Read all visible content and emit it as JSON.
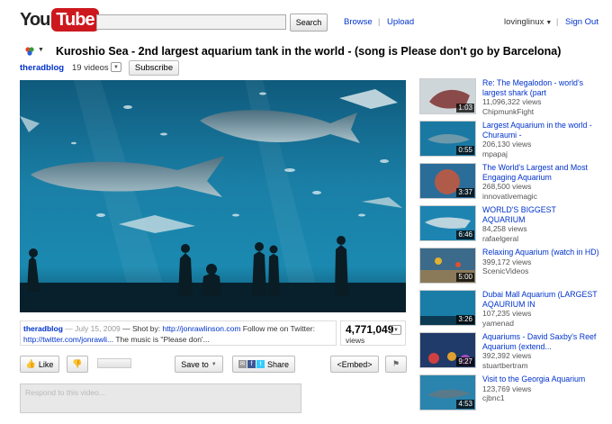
{
  "header": {
    "logo_you": "You",
    "logo_tube": "Tube",
    "search_button": "Search",
    "search_placeholder": "",
    "nav_browse": "Browse",
    "nav_upload": "Upload",
    "separator": "|",
    "username": "lovinglinux",
    "sign_out": "Sign Out"
  },
  "video": {
    "title": "Kuroshio Sea - 2nd largest aquarium tank in the world - (song is Please don't go by Barcelona)",
    "channel": "theradblog",
    "video_count": "19 videos",
    "subscribe": "Subscribe",
    "desc_channel": "theradblog",
    "desc_date": " — July 15, 2009",
    "desc_text_1": " — Shot by: ",
    "desc_link_1": "http://jonrawlinson.com",
    "desc_text_2": " Follow me on Twitter: ",
    "desc_link_2": "http://twitter.com/jonrawli...",
    "desc_text_3": " The music is \"Please don'...",
    "views_count": "4,771,049",
    "views_label": "views"
  },
  "actions": {
    "like": "Like",
    "save_to": "Save to",
    "share": "Share",
    "embed": "<Embed>",
    "respond_placeholder": "Respond to this video..."
  },
  "related": [
    {
      "title": "Re: The Megalodon - world's largest shark (part",
      "views": "11,096,322 views",
      "user": "ChipmunkFight",
      "duration": "1:03"
    },
    {
      "title": "Largest Aquarium in the world - Churaumi -",
      "views": "206,130 views",
      "user": "mpapaj",
      "duration": "0:55"
    },
    {
      "title": "The World's Largest and Most Engaging Aquarium",
      "views": "268,500 views",
      "user": "innovativemagic",
      "duration": "3:37"
    },
    {
      "title": "WORLD'S BIGGEST AQUARIUM",
      "views": "84,258 views",
      "user": "rafaelgeral",
      "duration": "6:46"
    },
    {
      "title": "Relaxing Aquarium (watch in HD)",
      "views": "399,172 views",
      "user": "ScenicVideos",
      "duration": "5:00"
    },
    {
      "title": "Dubai Mall Aquarium (LARGEST AQAURIUM IN",
      "views": "107,235 views",
      "user": "yamenad",
      "duration": "3:26"
    },
    {
      "title": "Aquariums - David Saxby's Reef Aquarium (extend...",
      "views": "392,392 views",
      "user": "stuartbertram",
      "duration": "9:27"
    },
    {
      "title": "Visit to the Georgia Aquarium",
      "views": "123,769 views",
      "user": "cjbnc1",
      "duration": "4:53"
    }
  ],
  "colors": {
    "link": "#0033cc",
    "youtube_red": "#cc181e",
    "water": "#1a6f93"
  }
}
